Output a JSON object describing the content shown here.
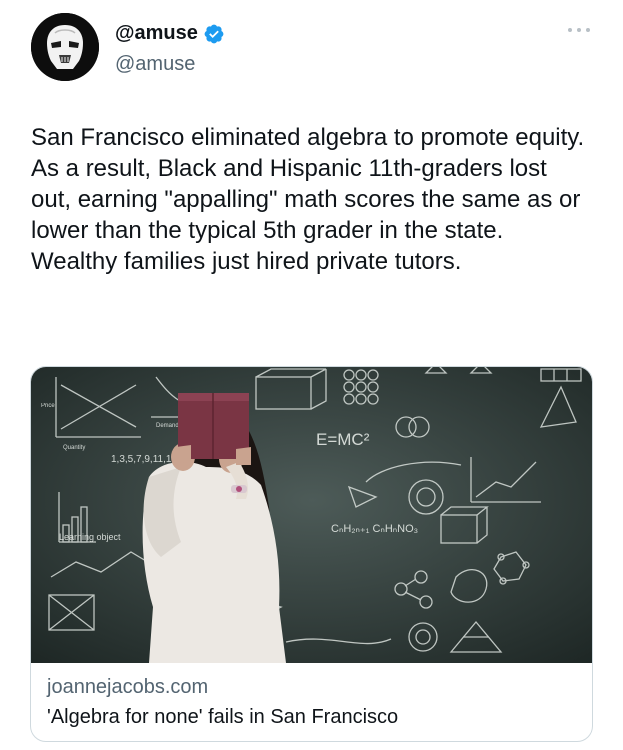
{
  "author": {
    "display_name": "@amuse",
    "handle": "@amuse",
    "verified": true,
    "accent_color": "#1d9bf0"
  },
  "icons": {
    "avatar": "stormtrooper-avatar",
    "badge": "verified-badge-icon",
    "more": "more-options-icon"
  },
  "tweet": {
    "text": "San Francisco eliminated algebra to promote equity. As a result, Black and Hispanic 11th-graders lost out, earning \"appalling\" math scores the same as or lower than the typical 5th grader in the state. Wealthy families just hired private tutors."
  },
  "card": {
    "domain": "joannejacobs.com",
    "title": "'Algebra for none' fails in San Francisco",
    "image": {
      "labels": {
        "emc": "E=MC²",
        "sequence": "1,3,5,7,9,11,13,15",
        "formula": "CₙH₂ₙ₊₁ CₙHₙNO₃",
        "learning": "Learning object",
        "quantity": "Quantity",
        "demand": "Demand",
        "price": "Price"
      }
    }
  }
}
